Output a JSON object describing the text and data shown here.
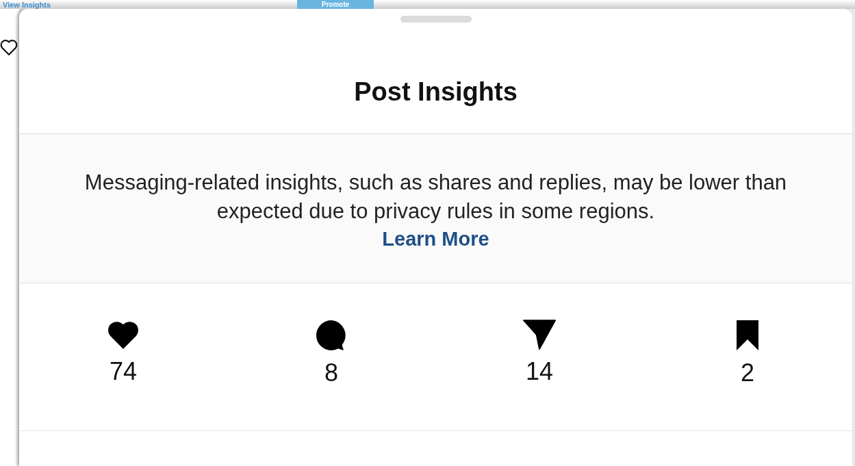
{
  "background": {
    "link": "View Insights",
    "button": "Promote"
  },
  "sheet": {
    "title": "Post Insights",
    "notice": {
      "text": "Messaging-related insights, such as shares and replies, may be lower than expected due to privacy rules in some regions.",
      "link": "Learn More"
    },
    "stats": [
      {
        "kind": "likes",
        "value": "74"
      },
      {
        "kind": "comments",
        "value": "8"
      },
      {
        "kind": "shares",
        "value": "14"
      },
      {
        "kind": "saves",
        "value": "2"
      }
    ]
  }
}
